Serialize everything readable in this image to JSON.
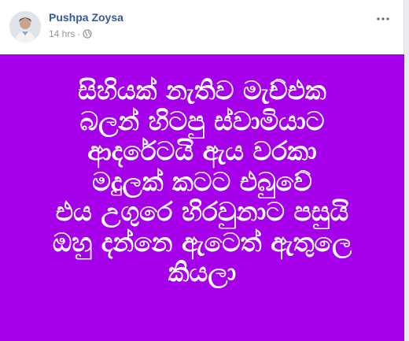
{
  "post": {
    "author": "Pushpa Zoysa",
    "timestamp": "14 hrs",
    "separator": "·",
    "privacy_icon": "globe-icon",
    "more_icon": "more-options-icon",
    "background_color": "#a500e9",
    "text_color": "#ffffff",
    "lines": [
      "සිහියක් නැතිව මැච්එක",
      "බලන් හිටපු ස්වාමියාට",
      "ආදරේටයි ඇය වරකා",
      "මදුලක් කටට එබුවේ",
      "එය උගුරෙ හිරවුනාට පසුයි",
      "ඔහු දන්නෙ ඇටෙත් ඇතුලෙ",
      "කියලා"
    ]
  }
}
